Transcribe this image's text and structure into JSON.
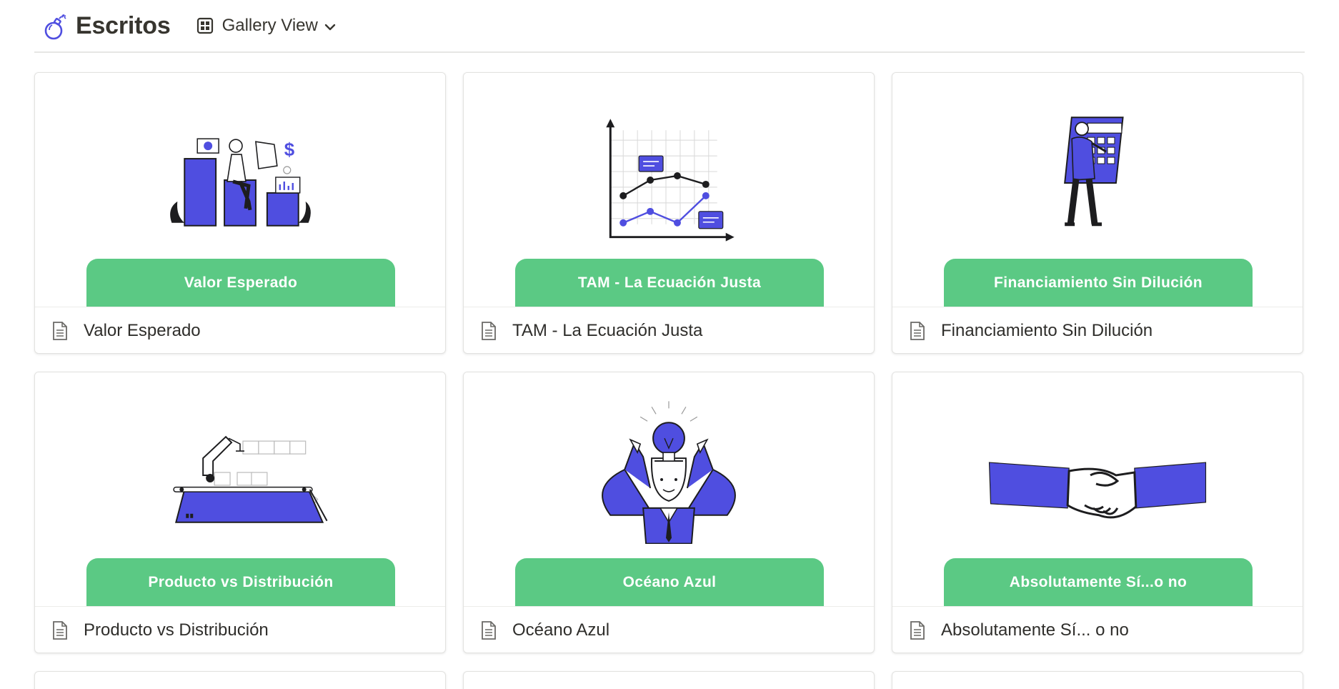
{
  "database": {
    "title": "Escritos",
    "icon": "bomb-icon"
  },
  "view_switcher": {
    "label": "Gallery View",
    "icon": "gallery-grid-icon",
    "chevron": "chevron-down-icon"
  },
  "colors": {
    "accent_green": "#5bc984",
    "illustration_blue": "#4f4ee0",
    "text": "#37352f"
  },
  "cards": [
    {
      "cover_text": "Valor Esperado",
      "title": "Valor Esperado",
      "illustration": "bar-chart-person-illustration"
    },
    {
      "cover_text": "TAM - La Ecuación Justa",
      "title": "TAM - La Ecuación Justa",
      "illustration": "line-chart-illustration"
    },
    {
      "cover_text": "Financiamiento Sin Dilución",
      "title": "Financiamiento Sin Dilución",
      "illustration": "calculator-person-illustration"
    },
    {
      "cover_text": "Producto vs Distribución",
      "title": "Producto vs Distribución",
      "illustration": "conveyor-robot-illustration"
    },
    {
      "cover_text": "Océano Azul",
      "title": "Océano Azul",
      "illustration": "lightbulb-head-illustration"
    },
    {
      "cover_text": "Absolutamente Sí...o no",
      "title": "Absolutamente Sí... o no",
      "illustration": "handshake-illustration"
    }
  ]
}
